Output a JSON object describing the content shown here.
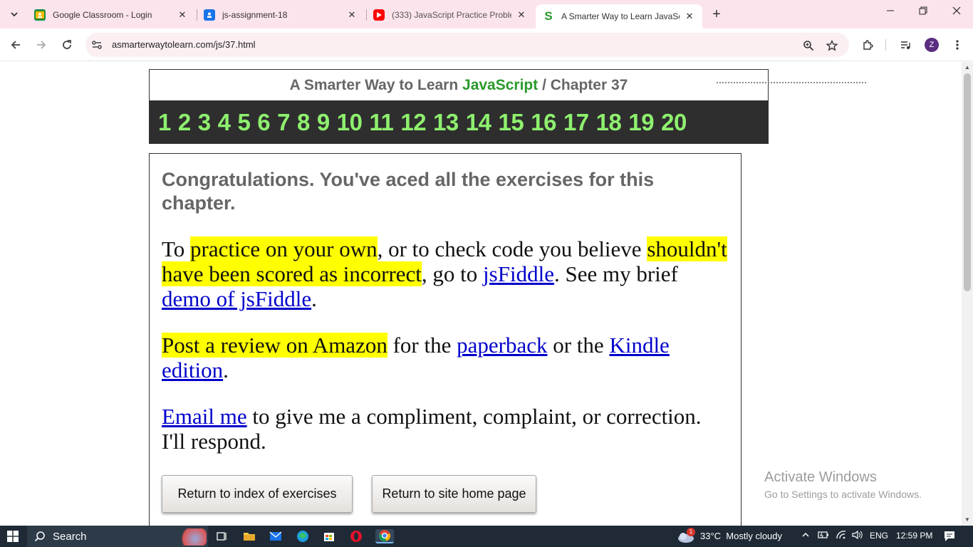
{
  "browser": {
    "tabs": [
      {
        "title": "Google Classroom - Login",
        "active": false,
        "favicon": "classroom-icon"
      },
      {
        "title": "js-assignment-18",
        "active": false,
        "favicon": "classroom-assignment-icon"
      },
      {
        "title": "(333) JavaScript Practice Proble",
        "active": false,
        "favicon": "youtube-icon"
      },
      {
        "title": "A Smarter Way to Learn JavaSc",
        "active": true,
        "favicon": "smarter-way-icon"
      }
    ],
    "url": "asmarterwaytolearn.com/js/37.html",
    "profile_initial": "Z"
  },
  "page": {
    "header": {
      "prefix": "A Smarter Way to Learn ",
      "highlight": "JavaScript",
      "separator": " / ",
      "chapter": "Chapter 37"
    },
    "chapters": [
      "1",
      "2",
      "3",
      "4",
      "5",
      "6",
      "7",
      "8",
      "9",
      "10",
      "11",
      "12",
      "13",
      "14",
      "15",
      "16",
      "17",
      "18",
      "19",
      "20"
    ],
    "congrats": "Congratulations. You've aced all the exercises for this chapter.",
    "p1": {
      "t1": "To ",
      "h1": "practice on your own",
      "t2": ", or to check code you believe ",
      "h2": "shouldn't have been scored as incorrect",
      "t3": ", go to ",
      "l1": "jsFiddle",
      "t4": ". See my brief ",
      "l2": "demo of jsFiddle",
      "t5": "."
    },
    "p2": {
      "h1": "Post a review on Amazon",
      "t1": " for the ",
      "l1": "paperback",
      "t2": " or the ",
      "l2": "Kindle edition",
      "t3": "."
    },
    "p3": {
      "l1": "Email me",
      "t1": " to give me a compliment, complaint, or correction. I'll respond."
    },
    "buttons": {
      "index": "Return to index of exercises",
      "home": "Return to site home page"
    },
    "watermark": {
      "line1": "Activate Windows",
      "line2": "Go to Settings to activate Windows."
    }
  },
  "taskbar": {
    "search": "Search",
    "weather": "33°C  Mostly cloudy",
    "weather_badge": "1",
    "lang": "ENG",
    "time": "12:59 PM"
  },
  "colors": {
    "tabstrip": "#fce4ec",
    "chapter_bar": "#2e2e2e",
    "chapter_link": "#8ef06e",
    "js_green": "#2b9a2b",
    "highlight": "#ffff00",
    "link": "#0000cc"
  }
}
